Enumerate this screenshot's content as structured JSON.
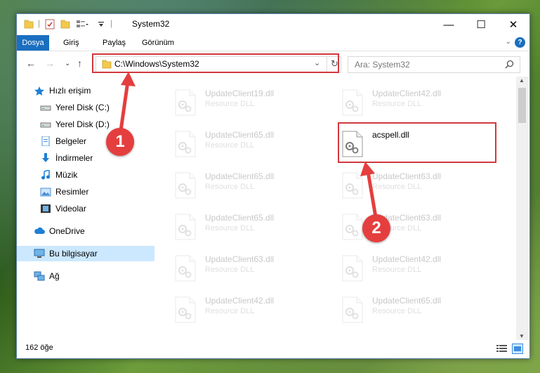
{
  "window": {
    "title": "System32"
  },
  "window_controls": {
    "minimize": "—",
    "maximize": "☐",
    "close": "✕"
  },
  "ribbon": {
    "tabs": [
      "Dosya",
      "Giriş",
      "Paylaş",
      "Görünüm"
    ],
    "help": "?"
  },
  "address": {
    "path": "C:\\Windows\\System32"
  },
  "search": {
    "placeholder": "Ara: System32"
  },
  "sidebar": {
    "items": [
      {
        "label": "Hızlı erişim",
        "icon": "star-icon"
      },
      {
        "label": "Yerel Disk (C:)",
        "icon": "drive-icon",
        "pinned": true
      },
      {
        "label": "Yerel Disk (D:)",
        "icon": "drive-icon",
        "pinned": true
      },
      {
        "label": "Belgeler",
        "icon": "documents-icon",
        "pinned": true
      },
      {
        "label": "İndirmeler",
        "icon": "download-icon",
        "pinned": true
      },
      {
        "label": "Müzik",
        "icon": "music-icon",
        "pinned": true
      },
      {
        "label": "Resimler",
        "icon": "pictures-icon",
        "pinned": true
      },
      {
        "label": "Videolar",
        "icon": "video-icon",
        "pinned": true
      },
      {
        "label": "OneDrive",
        "icon": "cloud-icon"
      },
      {
        "label": "Bu bilgisayar",
        "icon": "computer-icon",
        "selected": true
      },
      {
        "label": "Ağ",
        "icon": "network-icon"
      }
    ]
  },
  "files": {
    "left": [
      {
        "name": "UpdateClient19.dll",
        "desc": "Resource DLL"
      },
      {
        "name": "UpdateClient65.dll",
        "desc": "Resource DLL"
      },
      {
        "name": "UpdateClient65.dll",
        "desc": "Resource DLL"
      },
      {
        "name": "UpdateClient65.dll",
        "desc": "Resource DLL"
      },
      {
        "name": "UpdateClient63.dll",
        "desc": "Resource DLL"
      },
      {
        "name": "UpdateClient42.dll",
        "desc": "Resource DLL"
      }
    ],
    "right": [
      {
        "name": "UpdateClient42.dll",
        "desc": "Resource DLL"
      },
      {
        "name": "acspell.dll",
        "desc": "",
        "highlighted": true
      },
      {
        "name": "UpdateClient63.dll",
        "desc": "Resource DLL"
      },
      {
        "name": "UpdateClient63.dll",
        "desc": "Resource DLL"
      },
      {
        "name": "UpdateClient42.dll",
        "desc": "Resource DLL"
      },
      {
        "name": "UpdateClient65.dll",
        "desc": "Resource DLL"
      }
    ]
  },
  "status": {
    "count": "162 öğe"
  },
  "annotations": {
    "step1": "1",
    "step2": "2",
    "color": "#e53e3e"
  }
}
